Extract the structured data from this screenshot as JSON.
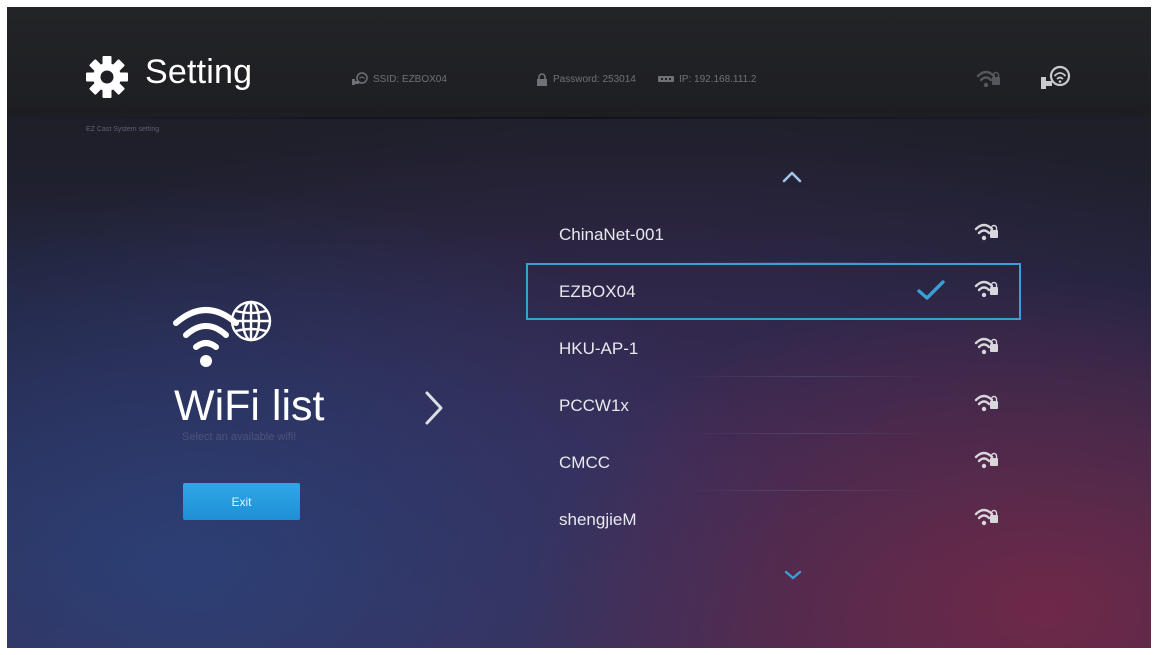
{
  "header": {
    "title": "Setting",
    "subtitle": "EZ Cast System setting",
    "ssid": "SSID: EZBOX04",
    "password": "Password: 253014",
    "ip": "IP: 192.168.111.2"
  },
  "panel": {
    "title": "WiFi list",
    "subtitle": "Select an available wifi!",
    "exit_label": "Exit"
  },
  "wifi_list": {
    "selected": "EZBOX04",
    "items": [
      {
        "ssid": "ChinaNet-001"
      },
      {
        "ssid": "EZBOX04"
      },
      {
        "ssid": "HKU-AP-1"
      },
      {
        "ssid": "PCCW1x"
      },
      {
        "ssid": "CMCC"
      },
      {
        "ssid": "shengjieM"
      }
    ]
  },
  "colors": {
    "accent": "#3a9fd5",
    "button": "#2ea7e7"
  },
  "icons": {
    "title": "gear-icon",
    "ssid": "network-icon",
    "password": "lock-icon",
    "ip": "ethernet-icon",
    "signal": "wifi-lock-signal-icon",
    "section": "wifi-globe-icon",
    "selected": "check-icon"
  }
}
